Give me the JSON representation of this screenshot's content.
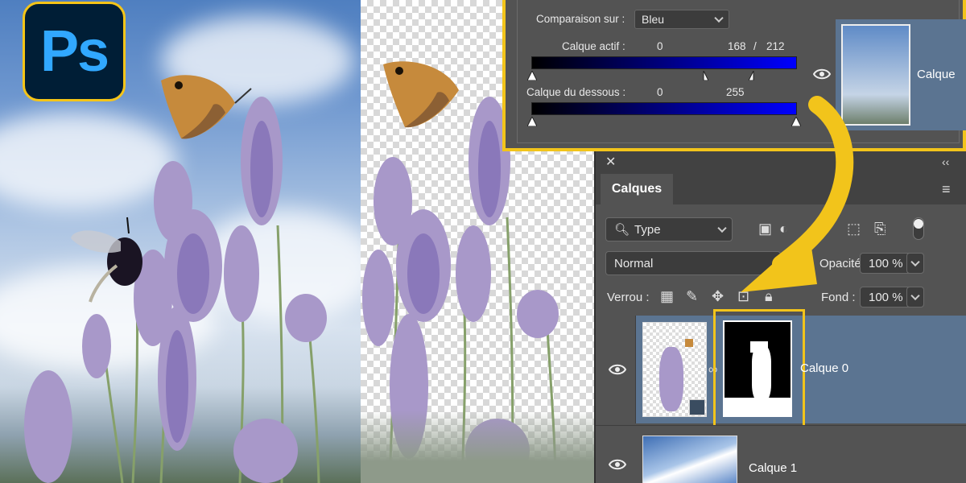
{
  "logo": {
    "text": "Ps"
  },
  "blend_if": {
    "compare_label": "Comparaison sur :",
    "compare_value": "Bleu",
    "this_layer_label": "Calque actif :",
    "this_layer_low": "0",
    "this_layer_high_a": "168",
    "slash": "/",
    "this_layer_high_b": "212",
    "underlying_label": "Calque du dessous :",
    "underlying_low": "0",
    "underlying_high": "255",
    "preview_label": "Calque"
  },
  "layers_panel": {
    "tab_label": "Calques",
    "filter_value": "Type",
    "blend_mode": "Normal",
    "opacity_label": "Opacité :",
    "opacity_value": "100 %",
    "lock_label": "Verrou :",
    "fill_label": "Fond :",
    "fill_value": "100 %",
    "layers": [
      {
        "name": "Calque 0"
      },
      {
        "name": "Calque 1"
      }
    ]
  },
  "colors": {
    "highlight": "#f2c41b",
    "selected_row": "#5b7491",
    "panel": "#535353",
    "ps_blue": "#31a8ff"
  }
}
